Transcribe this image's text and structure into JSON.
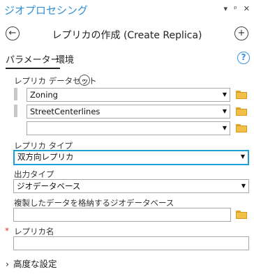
{
  "pane": {
    "title": "ジオプロセシング",
    "controls": [
      "▾",
      "ᵖ",
      "✕"
    ]
  },
  "tool": {
    "title": "レプリカの作成 (Create Replica)",
    "back_icon": "back-arrow-icon",
    "add_icon": "plus-icon"
  },
  "tabs": {
    "parameters": "パラメーター",
    "environments": "環境",
    "help": "?"
  },
  "replica_datasets": {
    "label": "レプリカ データセット",
    "rows": [
      {
        "value": "Zoning"
      },
      {
        "value": "StreetCenterlines"
      },
      {
        "value": ""
      }
    ]
  },
  "replica_type": {
    "label": "レプリカ タイプ",
    "value": "双方向レプリカ"
  },
  "output_type": {
    "label": "出力タイプ",
    "value": "ジオデータベース"
  },
  "target_gdb": {
    "label": "複製したデータを格納するジオデータベース",
    "value": ""
  },
  "replica_name": {
    "required_mark": "*",
    "label": "レプリカ名",
    "value": ""
  },
  "advanced": {
    "label": "高度な設定",
    "chevron": "›"
  },
  "colors": {
    "accent": "#2e8fd8",
    "focus": "#1ba1d6",
    "folder": "#f2c046",
    "required": "#d0422b"
  }
}
